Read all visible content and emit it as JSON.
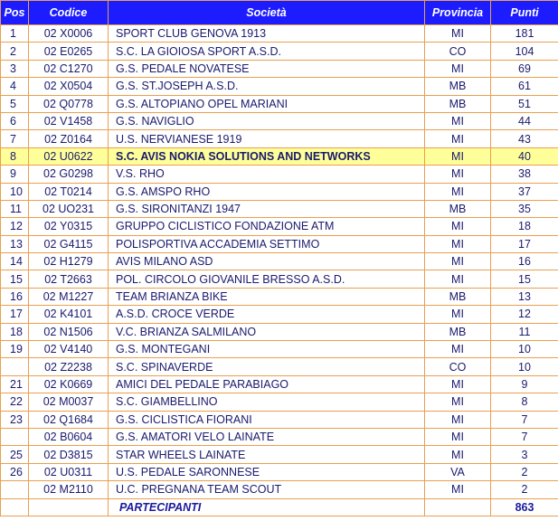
{
  "headers": {
    "pos": "Pos",
    "codice": "Codice",
    "societa": "Società",
    "provincia": "Provincia",
    "punti": "Punti"
  },
  "rows": [
    {
      "pos": "1",
      "codice": "02 X0006",
      "societa": "SPORT CLUB GENOVA 1913",
      "provincia": "MI",
      "punti": "181"
    },
    {
      "pos": "2",
      "codice": "02 E0265",
      "societa": "S.C. LA GIOIOSA SPORT A.S.D.",
      "provincia": "CO",
      "punti": "104"
    },
    {
      "pos": "3",
      "codice": "02 C1270",
      "societa": "G.S. PEDALE NOVATESE",
      "provincia": "MI",
      "punti": "69"
    },
    {
      "pos": "4",
      "codice": "02 X0504",
      "societa": "G.S. ST.JOSEPH A.S.D.",
      "provincia": "MB",
      "punti": "61"
    },
    {
      "pos": "5",
      "codice": "02 Q0778",
      "societa": "G.S. ALTOPIANO OPEL MARIANI",
      "provincia": "MB",
      "punti": "51"
    },
    {
      "pos": "6",
      "codice": "02 V1458",
      "societa": "G.S. NAVIGLIO",
      "provincia": "MI",
      "punti": "44"
    },
    {
      "pos": "7",
      "codice": "02 Z0164",
      "societa": "U.S. NERVIANESE 1919",
      "provincia": "MI",
      "punti": "43"
    },
    {
      "pos": "8",
      "codice": "02 U0622",
      "societa": "S.C. AVIS NOKIA SOLUTIONS AND NETWORKS",
      "provincia": "MI",
      "punti": "40",
      "highlight": true
    },
    {
      "pos": "9",
      "codice": "02 G0298",
      "societa": "V.S. RHO",
      "provincia": "MI",
      "punti": "38"
    },
    {
      "pos": "10",
      "codice": "02 T0214",
      "societa": "G.S. AMSPO  RHO",
      "provincia": "MI",
      "punti": "37"
    },
    {
      "pos": "11",
      "codice": "02 UO231",
      "societa": "G.S. SIRONITANZI 1947",
      "provincia": "MB",
      "punti": "35"
    },
    {
      "pos": "12",
      "codice": "02 Y0315",
      "societa": "GRUPPO CICLISTICO FONDAZIONE ATM",
      "provincia": "MI",
      "punti": "18"
    },
    {
      "pos": "13",
      "codice": "02 G4115",
      "societa": "POLISPORTIVA ACCADEMIA SETTIMO",
      "provincia": "MI",
      "punti": "17"
    },
    {
      "pos": "14",
      "codice": "02 H1279",
      "societa": "AVIS MILANO ASD",
      "provincia": "MI",
      "punti": "16"
    },
    {
      "pos": "15",
      "codice": "02 T2663",
      "societa": "POL. CIRCOLO GIOVANILE BRESSO A.S.D.",
      "provincia": "MI",
      "punti": "15"
    },
    {
      "pos": "16",
      "codice": "02 M1227",
      "societa": "TEAM BRIANZA BIKE",
      "provincia": "MB",
      "punti": "13"
    },
    {
      "pos": "17",
      "codice": "02 K4101",
      "societa": "A.S.D. CROCE VERDE",
      "provincia": "MI",
      "punti": "12"
    },
    {
      "pos": "18",
      "codice": "02 N1506",
      "societa": "V.C. BRIANZA SALMILANO",
      "provincia": "MB",
      "punti": "11"
    },
    {
      "pos": "19",
      "codice": "02 V4140",
      "societa": "G.S. MONTEGANI",
      "provincia": "MI",
      "punti": "10"
    },
    {
      "pos": "",
      "codice": "02 Z2238",
      "societa": "S.C. SPINAVERDE",
      "provincia": "CO",
      "punti": "10"
    },
    {
      "pos": "21",
      "codice": "02 K0669",
      "societa": "AMICI DEL PEDALE PARABIAGO",
      "provincia": "MI",
      "punti": "9"
    },
    {
      "pos": "22",
      "codice": "02 M0037",
      "societa": "S.C. GIAMBELLINO",
      "provincia": "MI",
      "punti": "8"
    },
    {
      "pos": "23",
      "codice": "02 Q1684",
      "societa": "G.S. CICLISTICA FIORANI",
      "provincia": "MI",
      "punti": "7"
    },
    {
      "pos": "",
      "codice": "02 B0604",
      "societa": "G.S. AMATORI VELO LAINATE",
      "provincia": "MI",
      "punti": "7"
    },
    {
      "pos": "25",
      "codice": "02 D3815",
      "societa": "STAR WHEELS LAINATE",
      "provincia": "MI",
      "punti": "3"
    },
    {
      "pos": "26",
      "codice": "02 U0311",
      "societa": "U.S. PEDALE SARONNESE",
      "provincia": "VA",
      "punti": "2"
    },
    {
      "pos": "",
      "codice": "02 M2110",
      "societa": "U.C. PREGNANA TEAM SCOUT",
      "provincia": "MI",
      "punti": "2"
    }
  ],
  "footer": {
    "label": "PARTECIPANTI",
    "total": "863"
  },
  "colors": {
    "header_bg": "#1c1cff",
    "header_text": "#ffffff",
    "border": "#e8a050",
    "highlight_bg": "#ffff99",
    "text": "#1a1a6e"
  }
}
